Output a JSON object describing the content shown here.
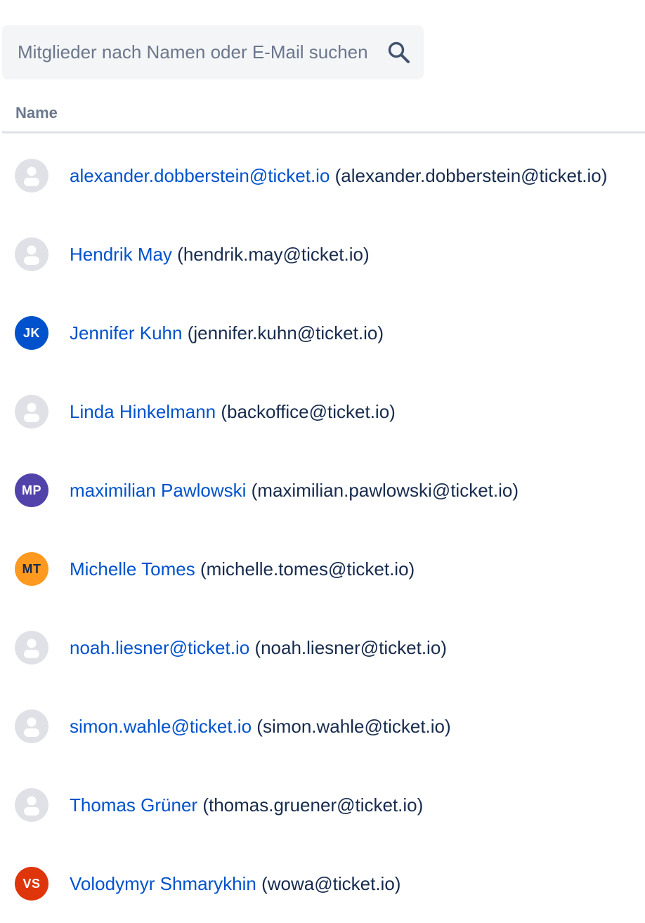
{
  "search": {
    "placeholder": "Mitglieder nach Namen oder E-Mail suchen",
    "icon": "search-icon"
  },
  "table": {
    "column_name": "Name"
  },
  "colors": {
    "link": "#0052cc",
    "text": "#172b4d",
    "default_avatar_bg": "#dfe1e6"
  },
  "members": [
    {
      "name": "alexander.dobberstein@ticket.io",
      "email": "(alexander.dobberstein@ticket.io)",
      "initials": "",
      "avatar_color": "",
      "avatar_text_color": ""
    },
    {
      "name": "Hendrik May",
      "email": "(hendrik.may@ticket.io)",
      "initials": "",
      "avatar_color": "",
      "avatar_text_color": ""
    },
    {
      "name": "Jennifer Kuhn",
      "email": "(jennifer.kuhn@ticket.io)",
      "initials": "JK",
      "avatar_color": "#0052cc",
      "avatar_text_color": "#ffffff"
    },
    {
      "name": "Linda Hinkelmann",
      "email": "(backoffice@ticket.io)",
      "initials": "",
      "avatar_color": "",
      "avatar_text_color": ""
    },
    {
      "name": "maximilian Pawlowski",
      "email": "(maximilian.pawlowski@ticket.io)",
      "initials": "MP",
      "avatar_color": "#5243aa",
      "avatar_text_color": "#ffffff"
    },
    {
      "name": "Michelle Tomes",
      "email": "(michelle.tomes@ticket.io)",
      "initials": "MT",
      "avatar_color": "#ff991f",
      "avatar_text_color": "#172b4d"
    },
    {
      "name": "noah.liesner@ticket.io",
      "email": "(noah.liesner@ticket.io)",
      "initials": "",
      "avatar_color": "",
      "avatar_text_color": ""
    },
    {
      "name": "simon.wahle@ticket.io",
      "email": "(simon.wahle@ticket.io)",
      "initials": "",
      "avatar_color": "",
      "avatar_text_color": ""
    },
    {
      "name": "Thomas Grüner",
      "email": "(thomas.gruener@ticket.io)",
      "initials": "",
      "avatar_color": "",
      "avatar_text_color": ""
    },
    {
      "name": "Volodymyr Shmarykhin",
      "email": "(wowa@ticket.io)",
      "initials": "VS",
      "avatar_color": "#de350b",
      "avatar_text_color": "#ffffff"
    }
  ]
}
